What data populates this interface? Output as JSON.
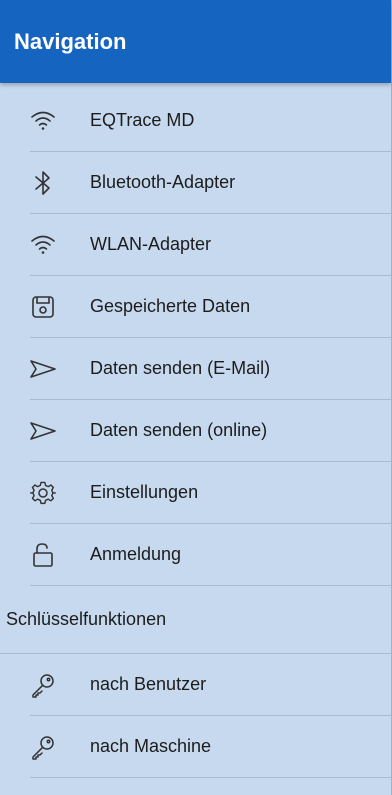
{
  "header": {
    "title": "Navigation"
  },
  "menu": {
    "items": [
      {
        "label": "EQTrace MD",
        "icon": "wifi-icon"
      },
      {
        "label": "Bluetooth-Adapter",
        "icon": "bluetooth-icon"
      },
      {
        "label": "WLAN-Adapter",
        "icon": "wifi-icon"
      },
      {
        "label": "Gespeicherte Daten",
        "icon": "save-icon"
      },
      {
        "label": "Daten senden (E-Mail)",
        "icon": "send-icon"
      },
      {
        "label": "Daten senden (online)",
        "icon": "send-icon"
      },
      {
        "label": "Einstellungen",
        "icon": "gear-icon"
      },
      {
        "label": "Anmeldung",
        "icon": "unlock-icon"
      }
    ],
    "section_title": "Schlüsselfunktionen",
    "section_items": [
      {
        "label": "nach Benutzer",
        "icon": "key-icon"
      },
      {
        "label": "nach Maschine",
        "icon": "key-icon"
      }
    ]
  },
  "colors": {
    "header_bg": "#1565c0",
    "drawer_bg": "#c7d9ee"
  }
}
